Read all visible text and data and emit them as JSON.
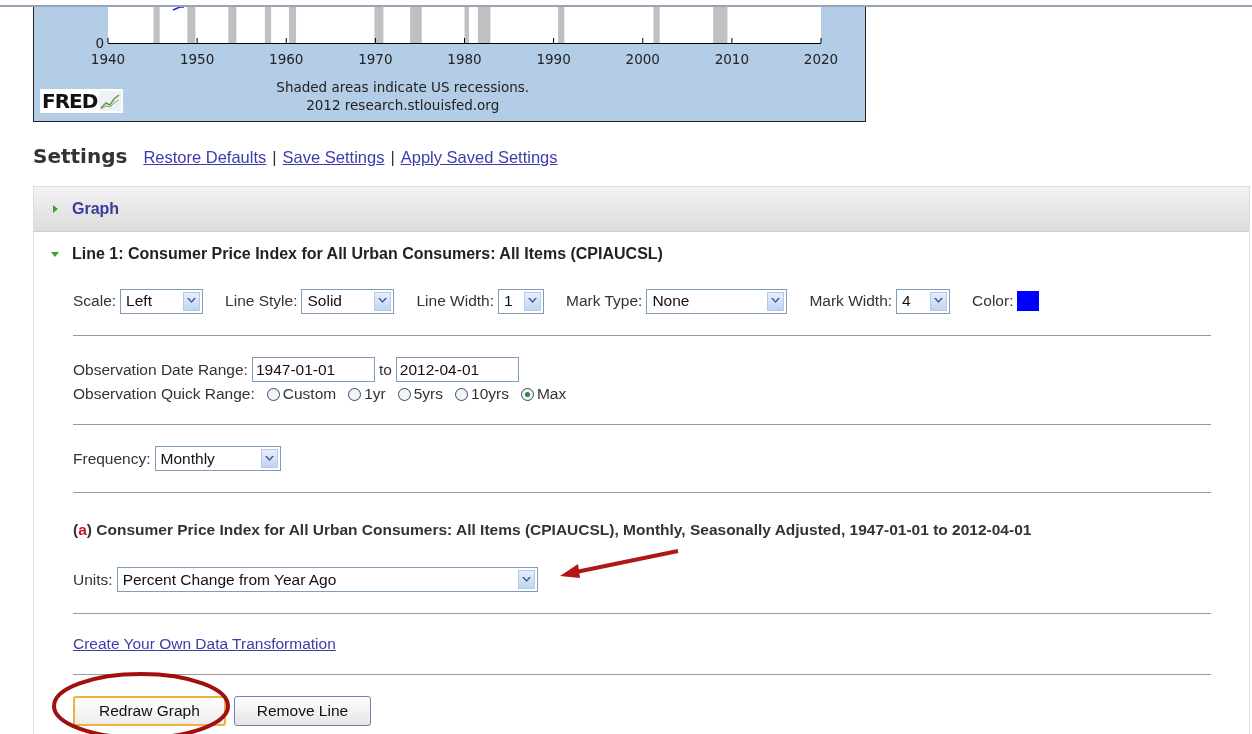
{
  "chart": {
    "x_labels": [
      "1940",
      "1950",
      "1960",
      "1970",
      "1980",
      "1990",
      "2000",
      "2010",
      "2020"
    ],
    "y_labels": [
      "0"
    ],
    "note": "Shaded areas indicate US recessions.",
    "source": "2012 research.stlouisfed.org",
    "logo": "FRED"
  },
  "settings": {
    "title": "Settings",
    "links": [
      "Restore Defaults",
      "Save Settings",
      "Apply Saved Settings"
    ],
    "separator": "|"
  },
  "sections": [
    {
      "title": "Graph",
      "expanded": false
    },
    {
      "title": "Line 1: Consumer Price Index for All Urban Consumers: All Items (CPIAUCSL)",
      "expanded": true
    }
  ],
  "line_options": [
    {
      "kind": "select",
      "label": "Scale:",
      "value": "Left"
    },
    {
      "kind": "select",
      "label": "Line Style:",
      "value": "Solid"
    },
    {
      "kind": "select",
      "label": "Line Width:",
      "value": "1"
    },
    {
      "kind": "select",
      "label": "Mark Type:",
      "value": "None"
    },
    {
      "kind": "select",
      "label": "Mark Width:",
      "value": "4"
    },
    {
      "kind": "color",
      "label": "Color:",
      "color": "#0000ff"
    }
  ],
  "date_range": {
    "label": "Observation Date Range:",
    "start": "1947-01-01",
    "joiner": "to",
    "end": "2012-04-01"
  },
  "quick_range": {
    "label": "Observation Quick Range:",
    "options": [
      {
        "label": "Custom",
        "selected": false
      },
      {
        "label": "1yr",
        "selected": false
      },
      {
        "label": "5yrs",
        "selected": false
      },
      {
        "label": "10yrs",
        "selected": false
      },
      {
        "label": "Max",
        "selected": true
      }
    ]
  },
  "frequency": {
    "label": "Frequency:",
    "value": "Monthly"
  },
  "series": {
    "open": "(",
    "letter": "a",
    "close": ")",
    "title": "Consumer Price Index for All Urban Consumers: All Items (CPIAUCSL), Monthly, Seasonally Adjusted, 1947-01-01 to 2012-04-01"
  },
  "units": {
    "label": "Units:",
    "value": "Percent Change from Year Ago"
  },
  "transformation_link": "Create Your Own Data Transformation",
  "buttons": [
    {
      "label": "Redraw Graph",
      "focused": true
    },
    {
      "label": "Remove Line",
      "focused": false
    }
  ]
}
